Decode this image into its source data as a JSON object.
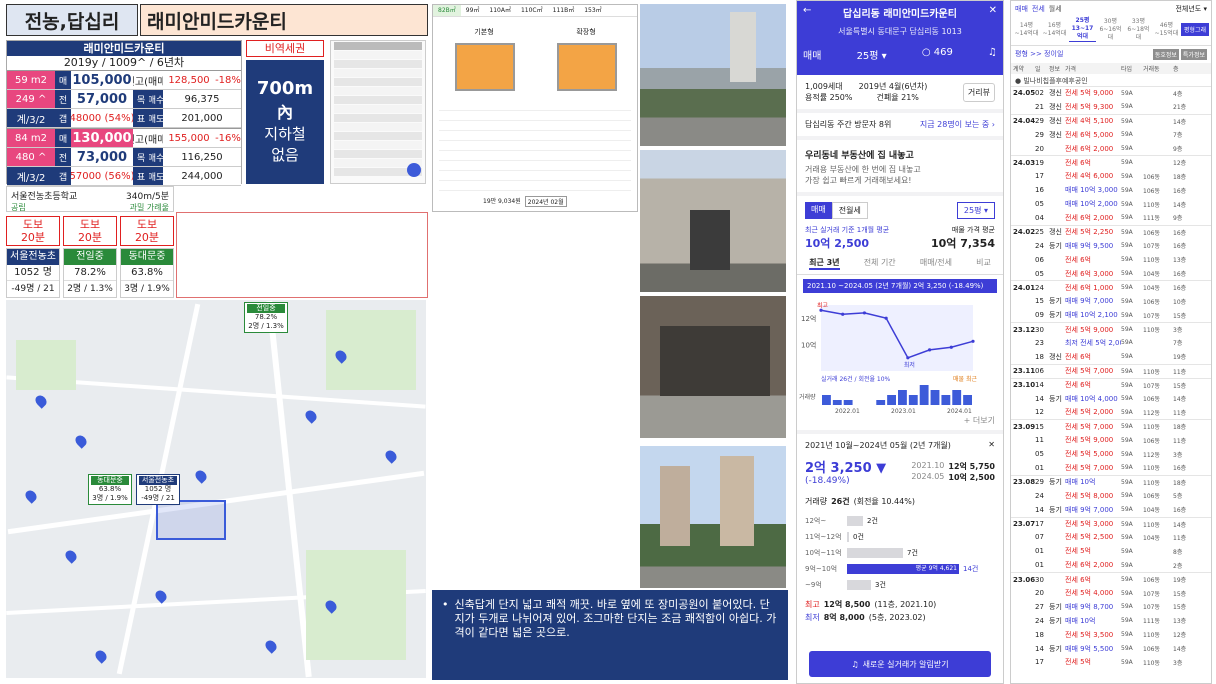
{
  "header": {
    "region": "전농,답십리",
    "complex": "래미안미드카운티"
  },
  "info_card": {
    "name": "래미안미드카운티",
    "meta": "2019y / 1009^ / 6년차",
    "sub1": {
      "size": "59 m2",
      "maemae_label": "매",
      "maemae": "105,000",
      "peak_label": "전고(매매)",
      "peak": "128,500",
      "peak_pct": "-18%",
      "households": "249 ^",
      "jeon_label": "전",
      "jeonse": "57,000",
      "mok_label": "목",
      "sale_label": "매수",
      "target_sale": "96,375",
      "floors": "계/3/2",
      "gap_label": "갭",
      "gap": "48000 (54%)",
      "pyo_label": "표",
      "do_label": "매도",
      "target_do": "201,000"
    },
    "sub2": {
      "size": "84 m2",
      "maemae_label": "매",
      "maemae": "130,000",
      "peak_label": "전고(매매)",
      "peak": "155,000",
      "peak_pct": "-16%",
      "households": "480 ^",
      "jeon_label": "전",
      "jeonse": "73,000",
      "mok_label": "목",
      "sale_label": "매수",
      "target_sale": "116,250",
      "floors": "계/3/2",
      "gap_label": "갭",
      "gap": "57000 (56%)",
      "pyo_label": "표",
      "do_label": "매도",
      "target_do": "244,000"
    }
  },
  "station": {
    "tag": "비역세권",
    "big1": "700m",
    "big2": "內",
    "big3": "지하철",
    "big4": "없음"
  },
  "school": {
    "name": "서울전농초등학교",
    "dist": "340m/5분",
    "type": "공립",
    "note": "과밀 가례울"
  },
  "walk": [
    {
      "l1": "도보",
      "l2": "20분"
    },
    {
      "l1": "도보",
      "l2": "20분"
    },
    {
      "l1": "도보",
      "l2": "20분"
    }
  ],
  "schools": [
    {
      "name": "서울전농초",
      "v1": "1052 명",
      "v2": "-49명 / 21"
    },
    {
      "name": "전일중",
      "v1": "78.2%",
      "v2": "2명 / 1.3%"
    },
    {
      "name": "동대문중",
      "v1": "63.8%",
      "v2": "3명 / 1.9%"
    }
  ],
  "map": {
    "label_top": {
      "name": "전일중",
      "v1": "78.2%",
      "v2": "2명 / 1.3%"
    },
    "label_a": {
      "name": "동대문중",
      "v1": "63.8%",
      "v2": "3명 / 1.9%"
    },
    "label_b": {
      "name": "서울전농초",
      "v1": "1052 명",
      "v2": "-49명 / 21"
    }
  },
  "plan": {
    "tabs": [
      "82B㎡",
      "99㎡",
      "110A㎡",
      "110C㎡",
      "111B㎡",
      "153㎡"
    ],
    "left_cap": "기본형",
    "right_cap": "확장형",
    "foot": "19만 9,034원",
    "foot2": "2024년 02월"
  },
  "note": {
    "bullet": "•",
    "text": "신축답게 단지 넓고 쾌적 깨끗. 바로 옆에 또 장미공원이 붙어있다. 단지가 두개로 나뉘어져 있어. 조그마한 단지는 조금 쾌적함이 아쉽다. 가격이 같다면 넓은 곳으로."
  },
  "app": {
    "title": "답십리동 래미안미드카운티",
    "address": "서울특별시 동대문구 답십리동 1013",
    "tab_trade": "매매",
    "size": "25평",
    "count": "469",
    "spec1": "1,009세대",
    "spec2": "2019년 4월(6년차)",
    "spec3": "용적률 250%",
    "spec4": "건폐율 21%",
    "dist_btn": "거리뷰",
    "visit": "답십리동 주간 방문자 8위",
    "visit_link": "지금 28명이 보는 중 ›",
    "promo_title": "우리동네 부동산에 집 내놓고",
    "promo_sub1": "거래용 부동산에 한 번에 집 내놓고",
    "promo_sub2": "가장 쉽고 빠르게 거래해보세요!",
    "seg_a": "매매",
    "seg_b": "전월세",
    "seg_size": "25평",
    "recent_label": "최근 실거래 기준 1개월 평균",
    "recent_val": "10억 2,500",
    "ask_label": "매물 가격 평균",
    "ask_val": "10억 7,354",
    "ptabs": [
      "최근 3년",
      "전체 기간",
      "매매/전세",
      "비교"
    ],
    "chart_banner": "2021.10 ~2024.05 (2년 7개월)  2억 3,250 (-18.49%)",
    "peak_tag": "최고",
    "low_tag": "최저",
    "legend_a": "실거래 26건 / 회전율 10%",
    "legend_b": "매물 최근",
    "trade_label": "거래량",
    "more": "+ 더보기",
    "x_ticks": [
      "2022.01",
      "2023.01",
      "2024.01"
    ],
    "period": "2021년 10월~2024년 05월 (2년 7개월)",
    "delta": "2억 3,250 ▼",
    "delta_pct": "(-18.49%)",
    "from_d": "2021.10",
    "from_v": "12억 5,750",
    "to_d": "2024.05",
    "to_v": "10억 2,500",
    "vol_label": "거래량",
    "vol_val": "26건",
    "vol_note": "(회전율 10.44%)",
    "hist": [
      {
        "r": "12억~",
        "n": "2건"
      },
      {
        "r": "11억~12억",
        "n": "0건"
      },
      {
        "r": "10억~11억",
        "n": "7건"
      },
      {
        "r": "9억~10억",
        "n": "14건",
        "hl": "평균 9억 4,621"
      },
      {
        "r": "~9억",
        "n": "3건"
      }
    ],
    "max_label": "최고",
    "max_val": "12억 8,500",
    "max_note": "(11층, 2021.10)",
    "min_label": "최저",
    "min_val": "8억 8,000",
    "min_note": "(5층, 2023.02)",
    "cta": "새로운 실거래가 알림받기"
  },
  "chart_data": {
    "type": "line",
    "title": "",
    "x": [
      "2021.10",
      "2022.01",
      "2022.06",
      "2022.10",
      "2023.01",
      "2023.06",
      "2024.01",
      "2024.05"
    ],
    "values": [
      12.6,
      12.3,
      12.4,
      12.0,
      9.0,
      9.6,
      9.8,
      10.25
    ],
    "ylim": [
      8,
      13
    ],
    "y_ticks": [
      "12억",
      "10억"
    ],
    "bars": [
      2,
      1,
      1,
      0,
      0,
      1,
      2,
      3,
      2,
      4,
      3,
      2,
      3,
      2
    ]
  },
  "deals": {
    "tabs": [
      "매매",
      "전세",
      "월세"
    ],
    "filter": "전체년도",
    "sizes": [
      "14평",
      "16평",
      "25평",
      "30평",
      "33평",
      "46평"
    ],
    "size_subs": [
      "~14억대",
      "~14억대",
      "13~17억대",
      "6~16억대",
      "6~18억대",
      "~15억대"
    ],
    "badge": "평형그래",
    "list_head": "평형 >> 정이일",
    "head_btns": [
      "동호정보",
      "특가정보"
    ],
    "cols": [
      "계약",
      "일",
      "정보",
      "가격",
      "타입",
      "거래동",
      "층"
    ],
    "rows": [
      [
        "24.05",
        "02",
        "갱신",
        "전세 5억 9,000",
        "59A",
        "",
        "4층"
      ],
      [
        "",
        "21",
        "갱신",
        "전세 5억 9,300",
        "59A",
        "",
        "21층"
      ],
      [
        "24.04",
        "29",
        "갱신",
        "전세 4억 5,100",
        "59A",
        "",
        "14층"
      ],
      [
        "",
        "29",
        "갱신",
        "전세 6억 5,000",
        "59A",
        "",
        "7층"
      ],
      [
        "",
        "20",
        "",
        "전세 6억 2,000",
        "59A",
        "",
        "9층"
      ],
      [
        "24.03",
        "19",
        "",
        "전세 6억",
        "59A",
        "",
        "12층"
      ],
      [
        "",
        "17",
        "",
        "전세 4억 6,000",
        "59A",
        "106동",
        "18층"
      ],
      [
        "",
        "16",
        "",
        "매매 10억 3,000",
        "59A",
        "106동",
        "16층"
      ],
      [
        "",
        "05",
        "",
        "매매 10억 2,000",
        "59A",
        "110동",
        "14층"
      ],
      [
        "",
        "04",
        "",
        "전세 6억 2,000",
        "59A",
        "111동",
        "9층"
      ],
      [
        "24.02",
        "25",
        "갱신",
        "전세 5억 2,250",
        "59A",
        "106동",
        "16층"
      ],
      [
        "",
        "24",
        "등기",
        "매매 9억 9,500",
        "59A",
        "107동",
        "16층"
      ],
      [
        "",
        "06",
        "",
        "전세 6억",
        "59A",
        "110동",
        "13층"
      ],
      [
        "",
        "05",
        "",
        "전세 6억 3,000",
        "59A",
        "104동",
        "16층"
      ],
      [
        "24.01",
        "24",
        "",
        "전세 6억 1,000",
        "59A",
        "104동",
        "16층"
      ],
      [
        "",
        "15",
        "등기",
        "매매 9억 7,000",
        "59A",
        "106동",
        "10층"
      ],
      [
        "",
        "09",
        "등기",
        "매매 10억 2,100",
        "59A",
        "107동",
        "15층"
      ],
      [
        "23.12",
        "30",
        "",
        "전세 5억 9,000",
        "59A",
        "110동",
        "3층"
      ],
      [
        "",
        "23",
        "",
        "최저 전세 5억 2,000",
        "59A",
        "",
        "7층"
      ],
      [
        "",
        "18",
        "갱신",
        "전세 6억",
        "59A",
        "",
        "19층"
      ],
      [
        "23.11",
        "06",
        "",
        "전세 5억 7,000",
        "59A",
        "110동",
        "11층"
      ],
      [
        "23.10",
        "14",
        "",
        "전세 6억",
        "59A",
        "107동",
        "15층"
      ],
      [
        "",
        "14",
        "등기",
        "매매 10억 4,000",
        "59A",
        "106동",
        "14층"
      ],
      [
        "",
        "12",
        "",
        "전세 5억 2,000",
        "59A",
        "112동",
        "11층"
      ],
      [
        "23.09",
        "15",
        "",
        "전세 5억 7,000",
        "59A",
        "110동",
        "18층"
      ],
      [
        "",
        "11",
        "",
        "전세 5억 9,000",
        "59A",
        "106동",
        "11층"
      ],
      [
        "",
        "05",
        "",
        "전세 5억 5,000",
        "59A",
        "112동",
        "3층"
      ],
      [
        "",
        "01",
        "",
        "전세 5억 7,000",
        "59A",
        "110동",
        "16층"
      ],
      [
        "23.08",
        "29",
        "등기",
        "매매 10억",
        "59A",
        "110동",
        "18층"
      ],
      [
        "",
        "24",
        "",
        "전세 5억 8,000",
        "59A",
        "106동",
        "5층"
      ],
      [
        "",
        "14",
        "등기",
        "매매 9억 7,000",
        "59A",
        "104동",
        "16층"
      ],
      [
        "23.07",
        "17",
        "",
        "전세 5억 3,000",
        "59A",
        "110동",
        "14층"
      ],
      [
        "",
        "07",
        "",
        "전세 5억 2,500",
        "59A",
        "104동",
        "11층"
      ],
      [
        "",
        "01",
        "",
        "전세 5억",
        "59A",
        "",
        "8층"
      ],
      [
        "",
        "01",
        "",
        "전세 6억 2,000",
        "59A",
        "",
        "2층"
      ],
      [
        "23.06",
        "30",
        "",
        "전세 6억",
        "59A",
        "106동",
        "19층"
      ],
      [
        "",
        "20",
        "",
        "전세 5억 4,000",
        "59A",
        "107동",
        "15층"
      ],
      [
        "",
        "27",
        "등기",
        "매매 9억 8,700",
        "59A",
        "107동",
        "15층"
      ],
      [
        "",
        "24",
        "등기",
        "매매 10억",
        "59A",
        "111동",
        "13층"
      ],
      [
        "",
        "18",
        "",
        "전세 5억 3,500",
        "59A",
        "110동",
        "12층"
      ],
      [
        "",
        "14",
        "등기",
        "매매 9억 5,500",
        "59A",
        "106동",
        "14층"
      ],
      [
        "",
        "17",
        "",
        "전세 5억",
        "59A",
        "110동",
        "3층"
      ]
    ]
  },
  "colors": {
    "blue": "#3d3dd6",
    "navy": "#1f3b7a",
    "red": "#e02020",
    "pink": "#e8477f"
  }
}
